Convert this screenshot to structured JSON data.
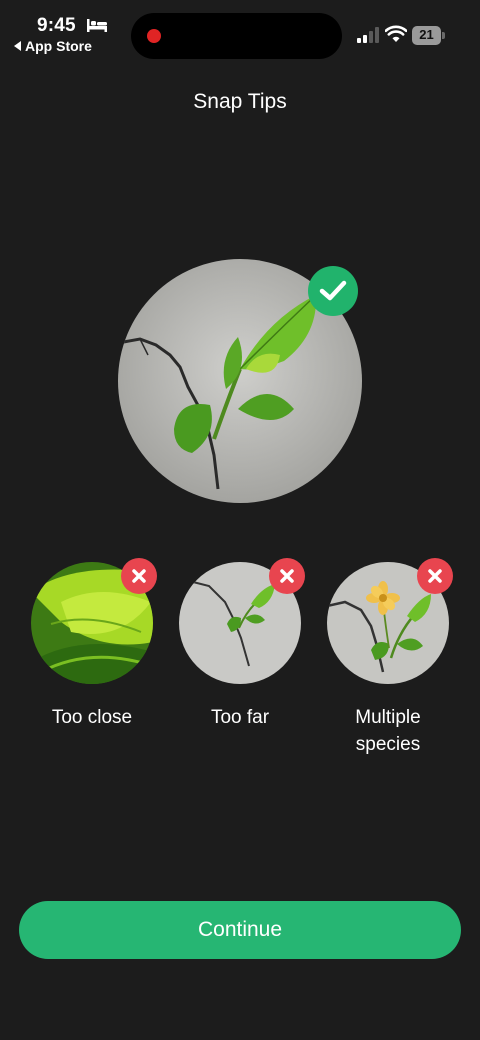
{
  "status_bar": {
    "time": "9:45",
    "back_app": "App Store",
    "battery": "21",
    "icons": [
      "bed-icon",
      "signal-icon",
      "wifi-icon",
      "battery-icon"
    ]
  },
  "page": {
    "title": "Snap Tips"
  },
  "good_example": {
    "badge": "check-icon",
    "accent": "#21b36c"
  },
  "bad_examples": [
    {
      "label_line1": "Too close",
      "label_line2": "",
      "badge": "x-icon"
    },
    {
      "label_line1": "Too far",
      "label_line2": "",
      "badge": "x-icon"
    },
    {
      "label_line1": "Multiple",
      "label_line2": "species",
      "badge": "x-icon"
    }
  ],
  "colors": {
    "background": "#1c1c1c",
    "success": "#21b36c",
    "error": "#e8454f",
    "button": "#26b673"
  },
  "continue_button": {
    "label": "Continue"
  }
}
